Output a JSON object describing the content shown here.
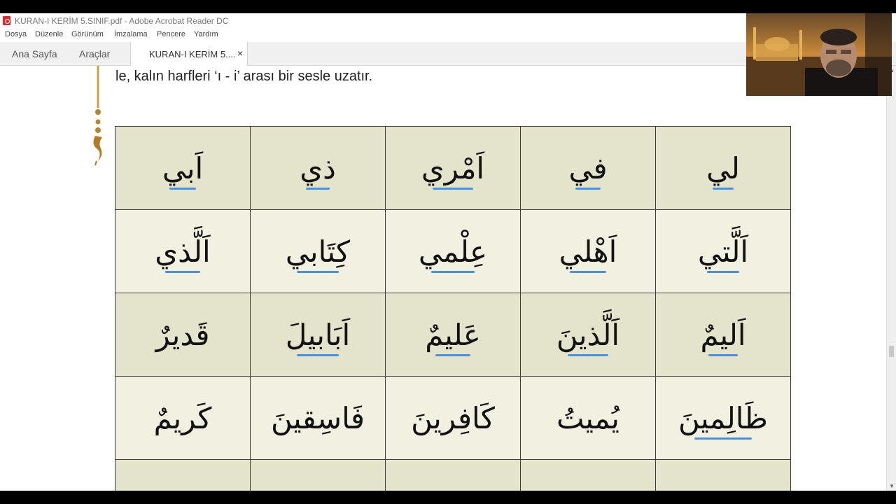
{
  "window": {
    "title": "KURAN-I KERİM 5.SINIF.pdf - Adobe Acrobat Reader DC"
  },
  "menu": {
    "items": [
      "Dosya",
      "Düzenle",
      "Görünüm",
      "İmzalama",
      "Pencere",
      "Yardım"
    ]
  },
  "tabs": {
    "home": "Ana Sayfa",
    "tools": "Araçlar",
    "document": "KURAN-I KERİM 5....",
    "close": "×"
  },
  "document": {
    "intro_text": "le, kalın harfleri ‘ı - i’ arası bir sesle uzatır.",
    "grid": [
      [
        "اَبي",
        "ذي",
        "اَمْري",
        "في",
        "لي"
      ],
      [
        "اَلَّذي",
        "كِتَابي",
        "عِلْمي",
        "اَهْلي",
        "اَلَّتي"
      ],
      [
        "قَديرٌ",
        "اَبَابيلَ",
        "عَليمٌ",
        "اَلَّذينَ",
        "اَليمٌ"
      ],
      [
        "كَريمٌ",
        "فَاسِقينَ",
        "كَافِرينَ",
        "يُميتُ",
        "ظَالِمينَ"
      ]
    ]
  },
  "scroll": {
    "up": "▲",
    "down": "▼"
  },
  "colors": {
    "row_dark": "#e4e3cc",
    "row_light": "#f1f0e1",
    "annotation": "#4a90e2",
    "acrobat_red": "#d32f2f"
  }
}
